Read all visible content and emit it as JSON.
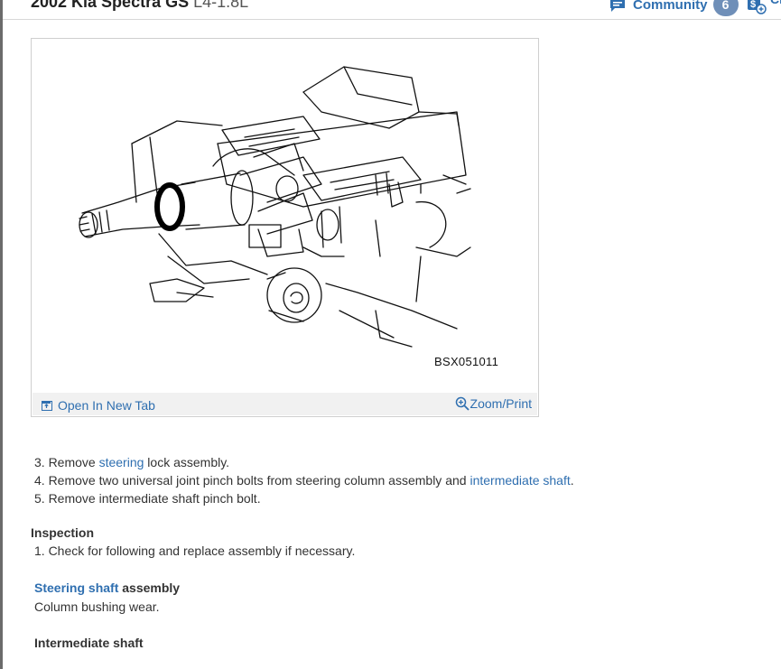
{
  "header": {
    "vehicle": "2002 Kia Spectra GS",
    "engine": "L4-1.8L",
    "community_label": "Community",
    "community_count": "6",
    "share_partial": "Ci"
  },
  "figure": {
    "image_code": "BSX051011",
    "open_tab_label": "Open In New Tab",
    "zoom_print_label": "Zoom/Print"
  },
  "steps": {
    "s3_prefix": "3. Remove ",
    "s3_link": "steering",
    "s3_suffix": " lock assembly.",
    "s4_prefix": "4. Remove two universal joint pinch bolts from steering column assembly and ",
    "s4_link": "intermediate shaft",
    "s4_suffix": ".",
    "s5": "5. Remove intermediate shaft pinch bolt."
  },
  "inspection": {
    "title": "Inspection",
    "step1": "1. Check for following and replace assembly if necessary."
  },
  "steering_shaft": {
    "link": "Steering shaft",
    "suffix": " assembly",
    "desc": "Column bushing wear."
  },
  "intermediate": {
    "heading": "Intermediate shaft"
  },
  "colors": {
    "link": "#2f6fb0",
    "badge": "#6f8fb8",
    "footer_bg": "#f1f1f1"
  }
}
